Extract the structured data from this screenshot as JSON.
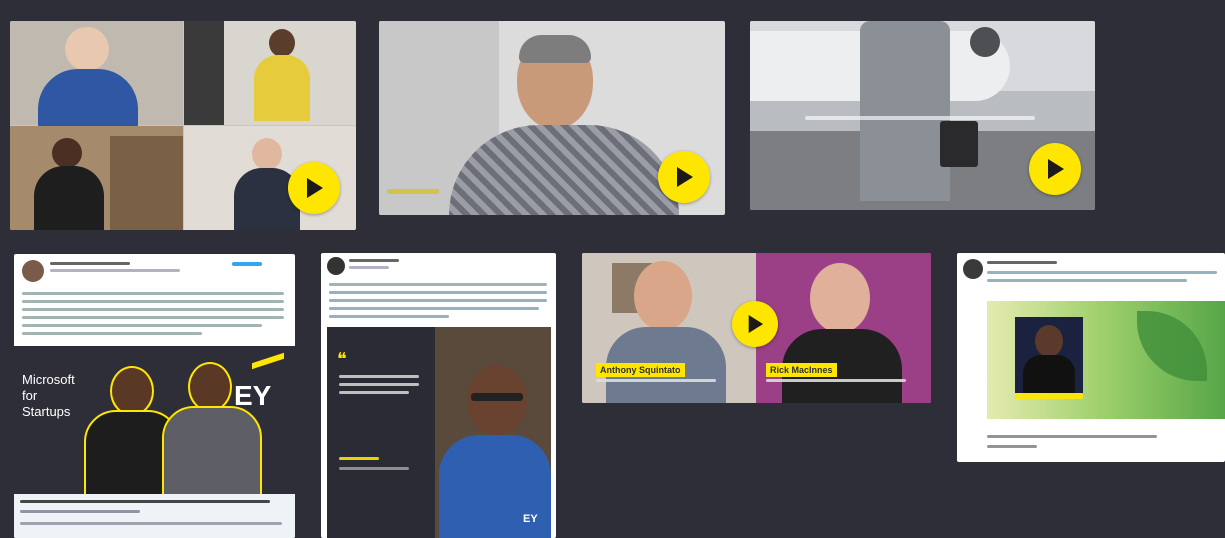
{
  "videos": [
    {
      "id": "v1"
    },
    {
      "id": "v2"
    },
    {
      "id": "v3"
    },
    {
      "id": "v4"
    }
  ],
  "tweets": {
    "t1": {
      "brand_left": "Microsoft for Startups",
      "brand_right": "EY"
    },
    "t2": {
      "quote_mark": "❝",
      "brand": "EY"
    },
    "t3": {}
  },
  "video4": {
    "name_left": "Anthony Squintato",
    "name_right": "Rick MacInnes"
  },
  "colors": {
    "background": "#2e2e38",
    "accent": "#ffe600",
    "link": "#1d9bf0"
  },
  "icons": {
    "play": "play-icon"
  }
}
